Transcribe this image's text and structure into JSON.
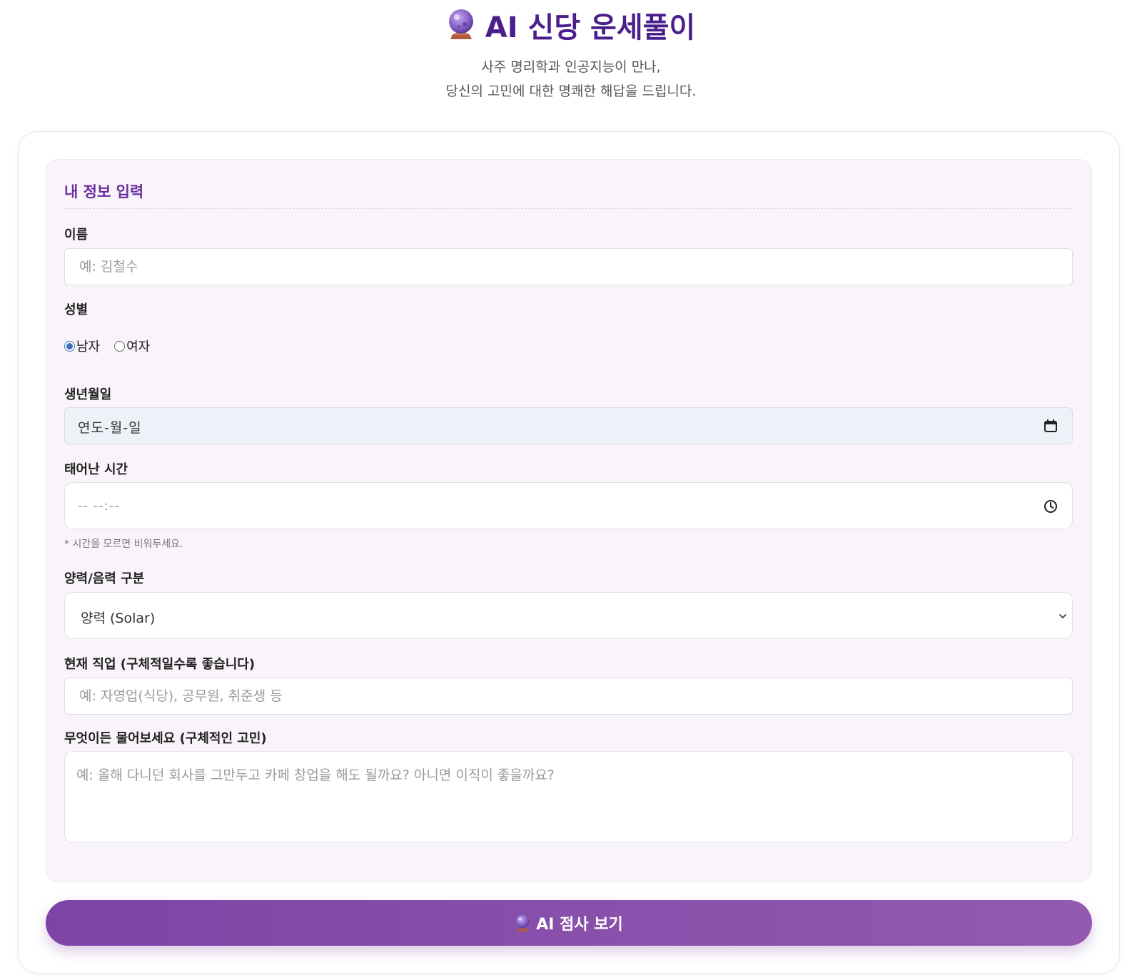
{
  "header": {
    "title": "AI 신당 운세풀이",
    "subtitle_line1": "사주 명리학과 인공지능이 만나,",
    "subtitle_line2": "당신의 고민에 대한 명쾌한 해답을 드립니다.",
    "icon": "crystal-ball-icon"
  },
  "form": {
    "section_title": "내 정보 입력",
    "name": {
      "label": "이름",
      "placeholder": "예: 김철수",
      "value": ""
    },
    "gender": {
      "label": "성별",
      "options": [
        {
          "label": "남자",
          "checked": true
        },
        {
          "label": "여자",
          "checked": false
        }
      ]
    },
    "birthdate": {
      "label": "생년월일",
      "display": "연도-월-일",
      "icon": "calendar-icon"
    },
    "birthtime": {
      "label": "태어난 시간",
      "display": "-- --:--",
      "icon": "clock-icon",
      "hint": "* 시간을 모르면 비워두세요."
    },
    "calendar_type": {
      "label": "양력/음력 구분",
      "selected": "양력 (Solar)",
      "icon": "chevron-down-icon"
    },
    "job": {
      "label": "현재 직업 (구체적일수록 좋습니다)",
      "placeholder": "예: 자영업(식당), 공무원, 취준생 등",
      "value": ""
    },
    "question": {
      "label": "무엇이든 물어보세요 (구체적인 고민)",
      "placeholder": "예: 올해 다니던 회사를 그만두고 카페 창업을 해도 될까요? 아니면 이직이 좋을까요?",
      "value": ""
    }
  },
  "submit": {
    "label": "AI 점사 보기",
    "icon": "crystal-ball-icon"
  },
  "colors": {
    "title": "#4a1f8c",
    "accent": "#7d44a6",
    "accent_end": "#935ab0",
    "panel_bg": "#f9f4fa",
    "radio_checked": "#3f6fb5"
  }
}
